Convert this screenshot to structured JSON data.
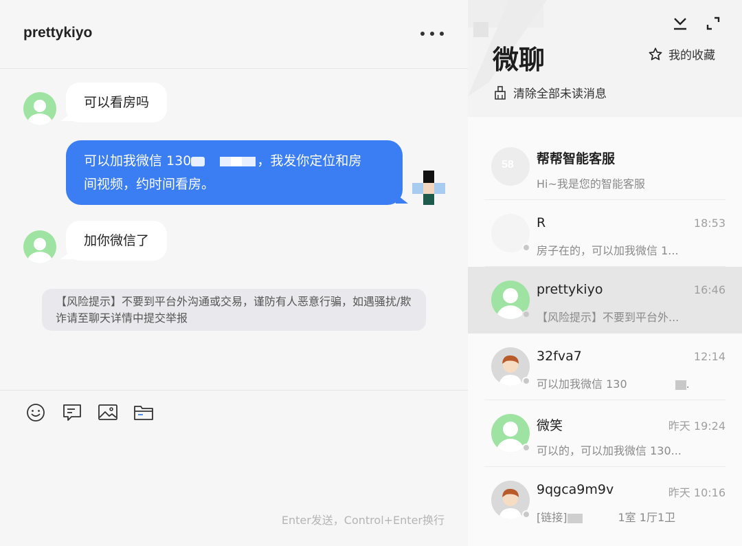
{
  "chat": {
    "title": "prettykiyo",
    "messages": [
      {
        "side": "in",
        "text": "可以看房吗"
      },
      {
        "side": "out",
        "text_line1_a": "可以加我微信 130",
        "text_line1_b": "，我发你定位和房",
        "text_line2": "间视频，约时间看房。"
      },
      {
        "side": "in",
        "text": "加你微信了"
      }
    ],
    "risk_notice": "【风险提示】不要到平台外沟通或交易，谨防有人恶意行骗，如遇骚扰/欺诈请至聊天详情中提交举报",
    "input_hint": "Enter发送，Control+Enter换行",
    "toolbar_icons": [
      "emoji-icon",
      "quick-reply-icon",
      "image-icon",
      "folder-icon"
    ]
  },
  "sidebar": {
    "title": "微聊",
    "favorites_label": "我的收藏",
    "clear_unread_label": "清除全部未读消息",
    "conversations": [
      {
        "name": "帮帮智能客服",
        "time": "",
        "preview": "Hi~我是您的智能客服",
        "avatar": "service"
      },
      {
        "name": "R",
        "time": "18:53",
        "preview": "房子在的，可以加我微信 1...",
        "avatar": "blank"
      },
      {
        "name": "prettykiyo",
        "time": "16:46",
        "preview": "【风险提示】不要到平台外...",
        "avatar": "green",
        "active": true
      },
      {
        "name": "32fva7",
        "time": "12:14",
        "preview": "可以加我微信 130",
        "avatar": "person"
      },
      {
        "name": "微笑",
        "time": "昨天 19:24",
        "preview": "可以的，可以加我微信 130...",
        "avatar": "green"
      },
      {
        "name": "9qgca9m9v",
        "time": "昨天 10:16",
        "preview": "[链接]",
        "preview_tail": "1室 1厅1卫",
        "avatar": "person"
      }
    ]
  },
  "colors": {
    "accent": "#3b7ef3",
    "active_row": "#e6e6e6",
    "avatar_green": "#9fe3a2"
  }
}
